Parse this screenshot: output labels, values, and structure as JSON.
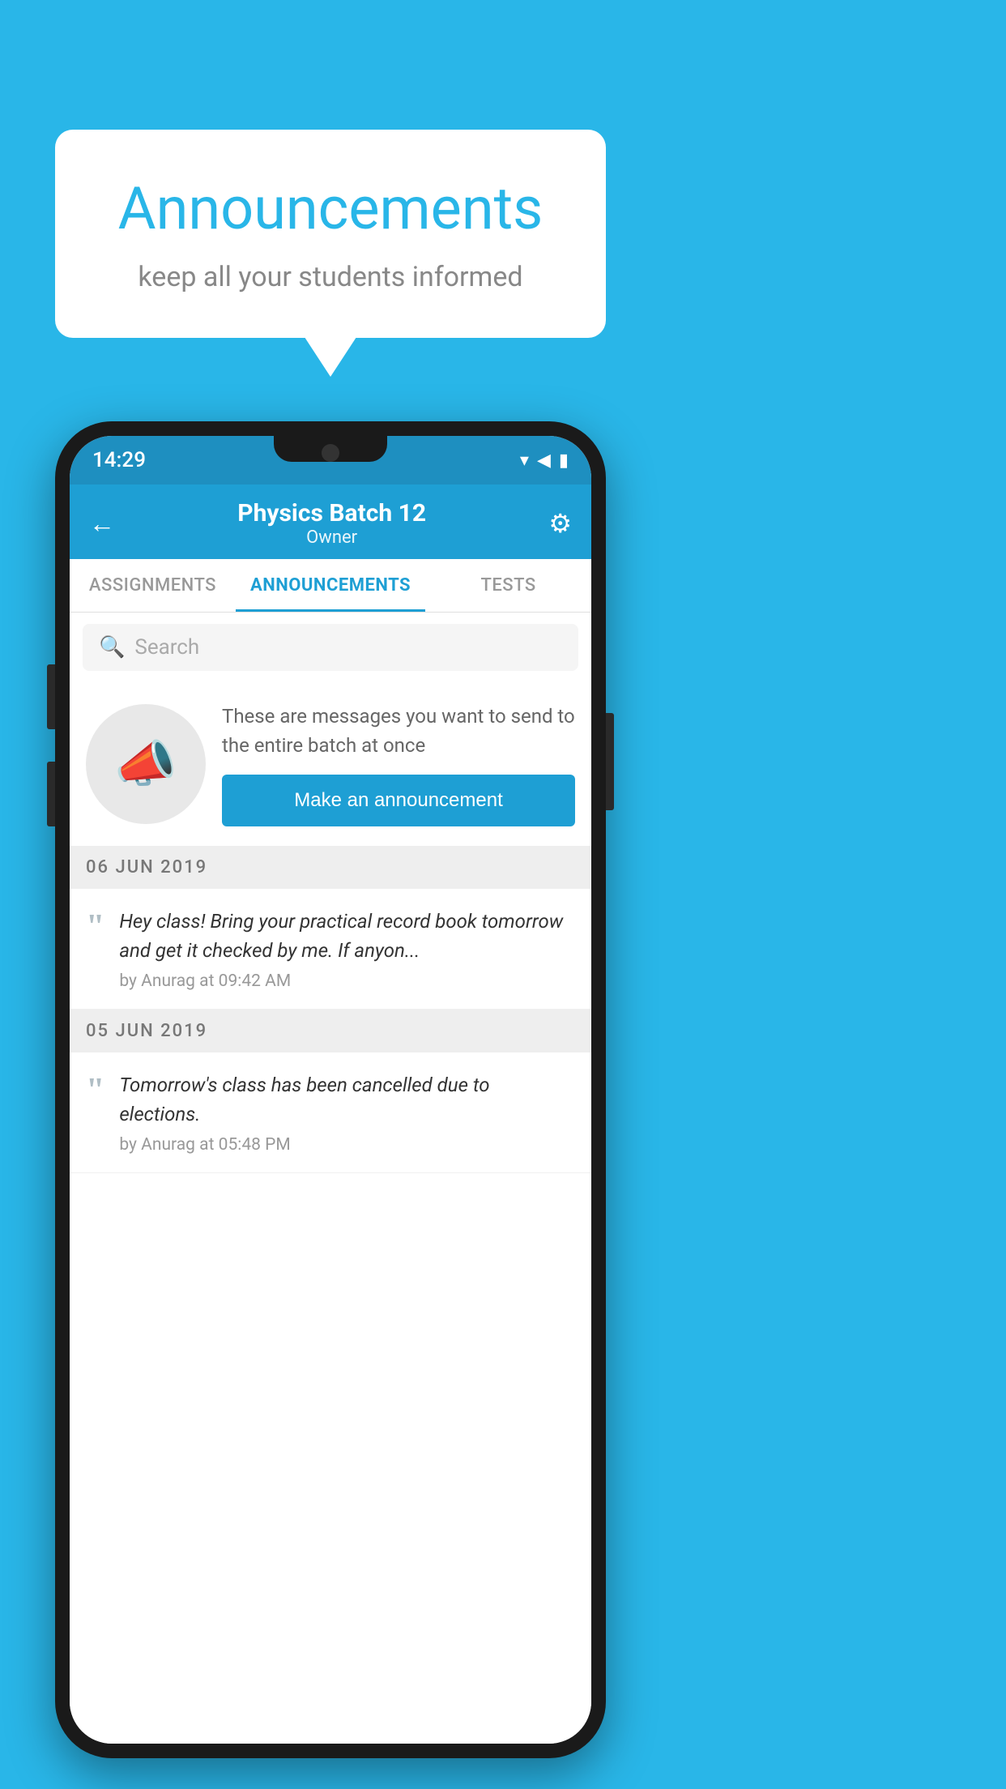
{
  "background_color": "#29b6e8",
  "speech_bubble": {
    "title": "Announcements",
    "subtitle": "keep all your students informed"
  },
  "phone": {
    "status_bar": {
      "time": "14:29",
      "wifi": "▾",
      "signal": "▲",
      "battery": "▮"
    },
    "header": {
      "back_label": "←",
      "title": "Physics Batch 12",
      "subtitle": "Owner",
      "gear_label": "⚙"
    },
    "tabs": [
      {
        "label": "ASSIGNMENTS",
        "active": false
      },
      {
        "label": "ANNOUNCEMENTS",
        "active": true
      },
      {
        "label": "TESTS",
        "active": false
      }
    ],
    "search": {
      "placeholder": "Search"
    },
    "promo": {
      "text": "These are messages you want to send to the entire batch at once",
      "button_label": "Make an announcement"
    },
    "announcements": [
      {
        "date": "06  JUN  2019",
        "items": [
          {
            "text": "Hey class! Bring your practical record book tomorrow and get it checked by me. If anyon...",
            "meta": "by Anurag at 09:42 AM"
          }
        ]
      },
      {
        "date": "05  JUN  2019",
        "items": [
          {
            "text": "Tomorrow's class has been cancelled due to elections.",
            "meta": "by Anurag at 05:48 PM"
          }
        ]
      }
    ]
  }
}
